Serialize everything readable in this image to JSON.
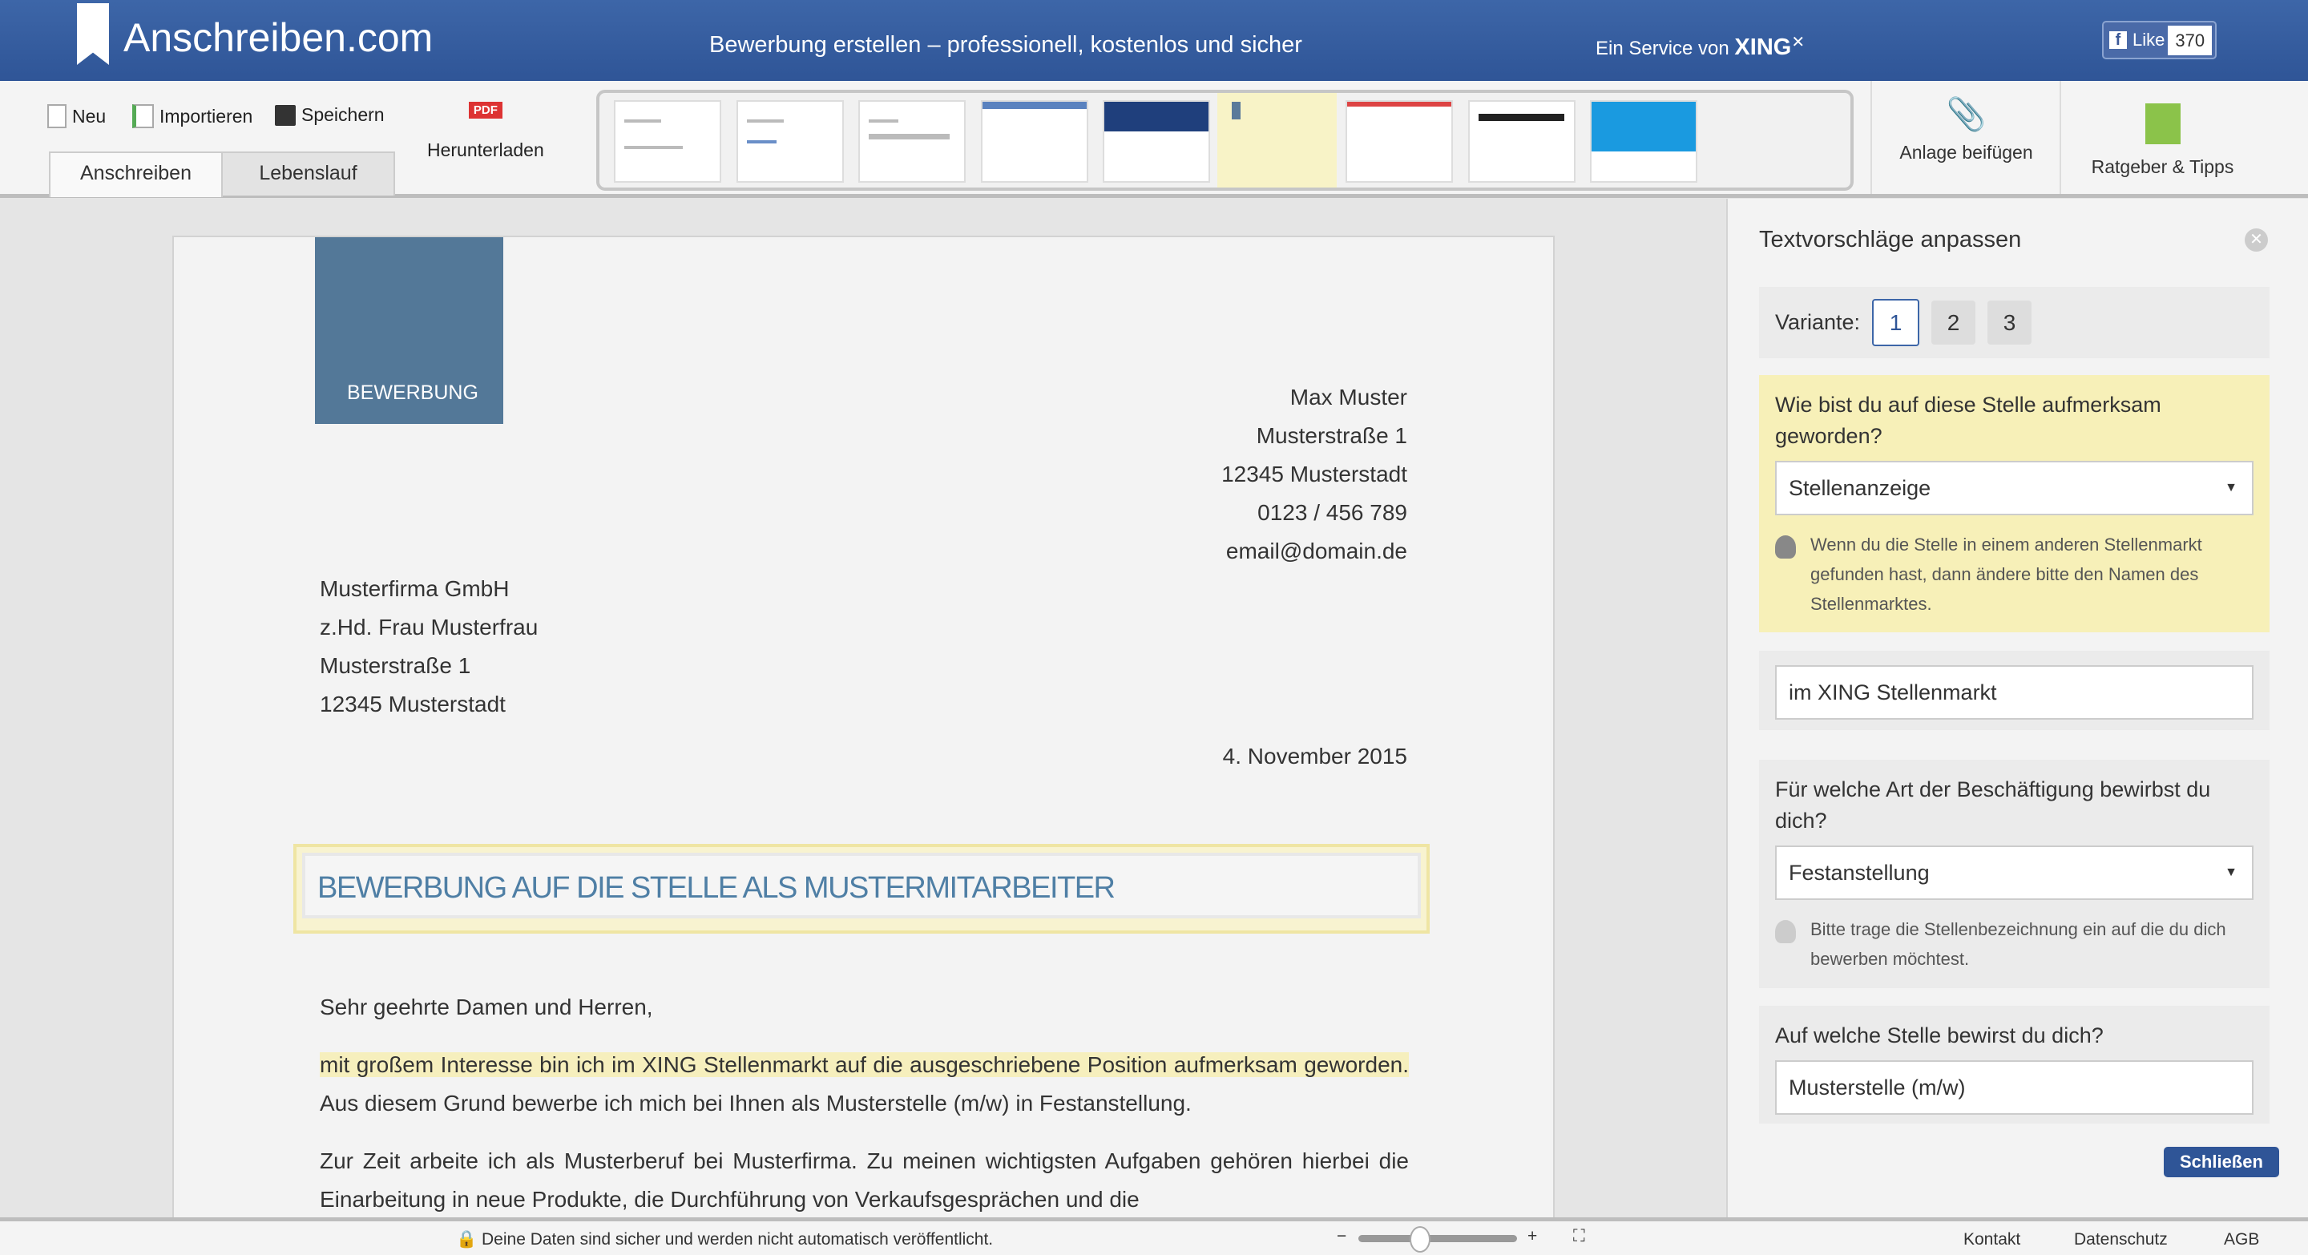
{
  "header": {
    "logo": "Anschreiben.com",
    "tagline": "Bewerbung erstellen – professionell, kostenlos und sicher",
    "service": "Ein Service von",
    "xing": "XING",
    "fb_like": "Like",
    "fb_count": "370"
  },
  "toolbar": {
    "new": "Neu",
    "import": "Importieren",
    "save": "Speichern",
    "download": "Herunterladen",
    "pdf": "PDF",
    "attach": "Anlage beifügen",
    "guide": "Ratgeber & Tipps"
  },
  "tabs": [
    {
      "label": "Anschreiben",
      "active": true
    },
    {
      "label": "Lebenslauf",
      "active": false
    }
  ],
  "templates": {
    "count": 9,
    "selected": 6
  },
  "letter": {
    "badge": "BEWERBUNG",
    "sender": [
      "Max Muster",
      "Musterstraße 1",
      "12345 Musterstadt",
      "0123 / 456 789",
      "email@domain.de"
    ],
    "recipient": [
      "Musterfirma GmbH",
      "z.Hd. Frau Musterfrau",
      "Musterstraße 1",
      "12345 Musterstadt"
    ],
    "date": "4. November 2015",
    "subject": "BEWERBUNG AUF DIE STELLE ALS MUSTERMITARBEITER",
    "salutation": "Sehr geehrte Damen und Herren,",
    "p1_highlight": "mit großem Interesse bin ich im XING Stellenmarkt auf die ausgeschriebene Position aufmerksam geworden.",
    "p1_rest": " Aus diesem Grund bewerbe ich mich bei Ihnen als Musterstelle (m/w) in Festanstellung.",
    "p2": "Zur Zeit arbeite ich als Musterberuf bei Musterfirma. Zu meinen wichtigsten Aufgaben gehören hierbei die Einarbeitung in neue Produkte, die Durchführung von Verkaufsgesprächen und die"
  },
  "panel": {
    "title": "Textvorschläge anpassen",
    "variant_label": "Variante:",
    "variants": [
      "1",
      "2",
      "3"
    ],
    "q1": "Wie bist du auf diese Stelle aufmerksam geworden?",
    "q1_value": "Stellenanzeige",
    "q1_hint": "Wenn du die Stelle in einem anderen Stellenmarkt gefunden hast, dann ändere bitte den Namen des Stellenmarktes.",
    "q1_input": "im XING Stellenmarkt",
    "q2": "Für welche Art der Beschäftigung bewirbst du dich?",
    "q2_value": "Festanstellung",
    "q2_hint": "Bitte trage die Stellenbezeichnung ein auf die du dich bewerben möchtest.",
    "q3": "Auf welche Stelle bewirst du dich?",
    "q3_value": "Musterstelle (m/w)",
    "close": "Schließen"
  },
  "footer": {
    "privacy": "Deine Daten sind sicher und werden nicht automatisch veröffentlicht.",
    "zoom_minus": "−",
    "zoom_plus": "+",
    "zoom_level": 0.38,
    "links": [
      "Kontakt",
      "Datenschutz",
      "AGB"
    ]
  },
  "colors": {
    "brand": "#2f5597",
    "highlight": "#f6efbd",
    "subject": "#4f7fa5"
  }
}
